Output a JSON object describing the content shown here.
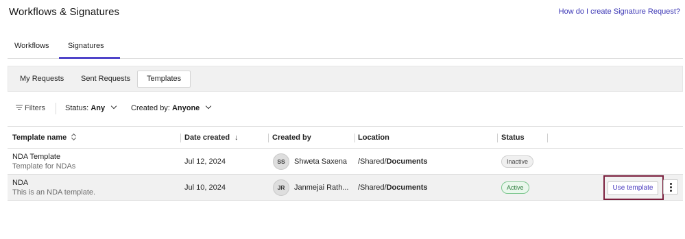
{
  "header": {
    "title": "Workflows & Signatures",
    "help_link": "How do I create Signature Request?"
  },
  "tabs": [
    {
      "label": "Workflows",
      "active": false
    },
    {
      "label": "Signatures",
      "active": true
    }
  ],
  "subtabs": [
    {
      "label": "My Requests",
      "active": false
    },
    {
      "label": "Sent Requests",
      "active": false
    },
    {
      "label": "Templates",
      "active": true
    }
  ],
  "filters": {
    "filters_label": "Filters",
    "status_label": "Status:",
    "status_value": "Any",
    "created_by_label": "Created by:",
    "created_by_value": "Anyone"
  },
  "table": {
    "columns": [
      "Template name",
      "Date created",
      "Created by",
      "Location",
      "Status"
    ],
    "rows": [
      {
        "name": "NDA Template",
        "description": "Template for NDAs",
        "date": "Jul 12, 2024",
        "initials": "SS",
        "creator": "Shweta Saxena",
        "location_prefix": "/Shared/",
        "location_folder": "Documents",
        "status": "Inactive"
      },
      {
        "name": "NDA",
        "description": "This is an NDA template.",
        "date": "Jul 10, 2024",
        "initials": "JR",
        "creator": "Janmejai Rath...",
        "location_prefix": "/Shared/",
        "location_folder": "Documents",
        "status": "Active",
        "action_label": "Use template"
      }
    ]
  },
  "colors": {
    "accent": "#4f43c9",
    "link": "#3b36b5",
    "highlight_border": "#7a1f3d",
    "active_badge": "#2f7d3f"
  }
}
